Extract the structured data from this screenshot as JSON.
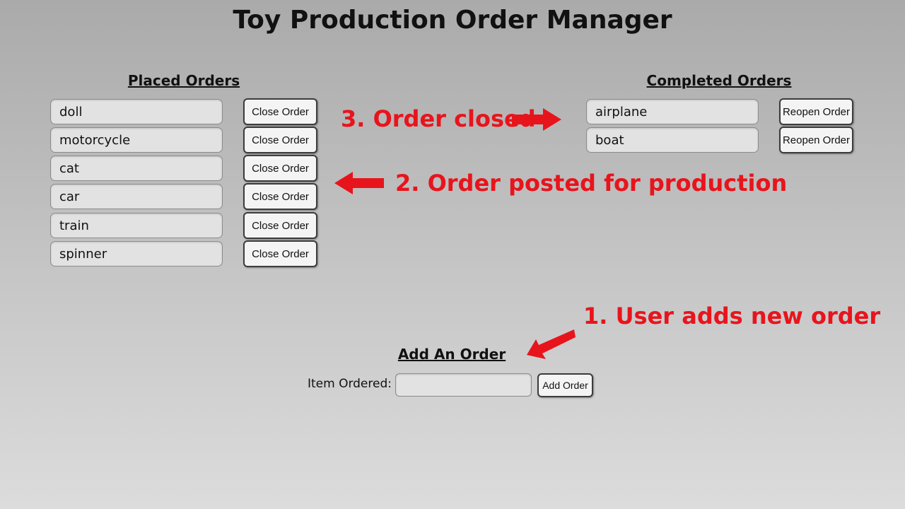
{
  "app": {
    "title": "Toy Production Order Manager"
  },
  "placed": {
    "heading": "Placed Orders",
    "button_label": "Close Order",
    "items": [
      "doll",
      "motorcycle",
      "cat",
      "car",
      "train",
      "spinner"
    ]
  },
  "completed": {
    "heading": "Completed Orders",
    "button_label": "Reopen Order",
    "items": [
      "airplane",
      "boat"
    ]
  },
  "add_form": {
    "heading": "Add An Order",
    "field_label": "Item Ordered:",
    "field_value": "",
    "button_label": "Add Order"
  },
  "annotations": {
    "step1": "1. User adds new order",
    "step2": "2. Order posted for production",
    "step3": "3. Order closed",
    "color": "#e8141c"
  }
}
